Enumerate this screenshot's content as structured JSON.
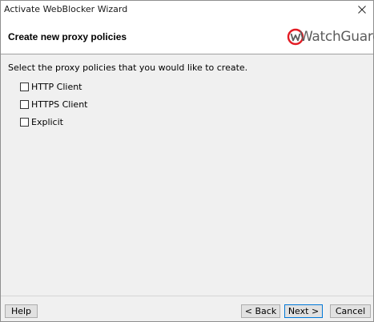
{
  "window": {
    "title": "Activate WebBlocker Wizard"
  },
  "header": {
    "title": "Create new proxy policies",
    "logo_text": "WatchGuard"
  },
  "main": {
    "instructions": "Select the proxy policies that you would like to create.",
    "options": [
      {
        "label": "HTTP Client",
        "checked": false
      },
      {
        "label": "HTTPS Client",
        "checked": false
      },
      {
        "label": "Explicit",
        "checked": false
      }
    ]
  },
  "footer": {
    "help_label": "Help",
    "back_label": "< Back",
    "next_label": "Next >",
    "cancel_label": "Cancel"
  },
  "colors": {
    "logo_red": "#e31b23",
    "logo_gray": "#5c5c5c",
    "focus_border": "#0078d7"
  },
  "icons": {
    "close": "close-icon",
    "logo": "watchguard-logo-icon"
  }
}
